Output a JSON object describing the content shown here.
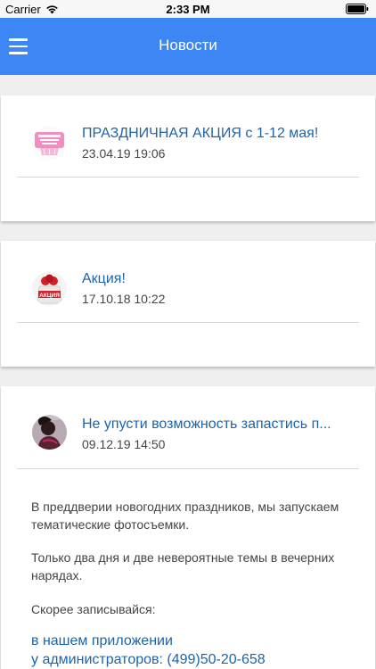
{
  "status_bar": {
    "carrier": "Carrier",
    "time": "2:33 PM"
  },
  "nav": {
    "title": "Новости",
    "accent_color": "#3c86f5"
  },
  "news": [
    {
      "title": "ПРАЗДНИЧНАЯ АКЦИЯ с 1-12 мая!",
      "date": "23.04.19 19:06"
    },
    {
      "title": "Акция!",
      "date": "17.10.18 10:22"
    },
    {
      "title": "Не упусти возможность запастись п...",
      "date": "09.12.19 14:50",
      "body": [
        "В преддверии новогодних праздников, мы запускаем тематические фотосъемки.",
        "Только два дня и две невероятные темы в вечерних нарядах.",
        "Скорее записывайся:"
      ],
      "links": [
        "в нашем приложении",
        "у администраторов: (499)50-20-658"
      ]
    }
  ]
}
